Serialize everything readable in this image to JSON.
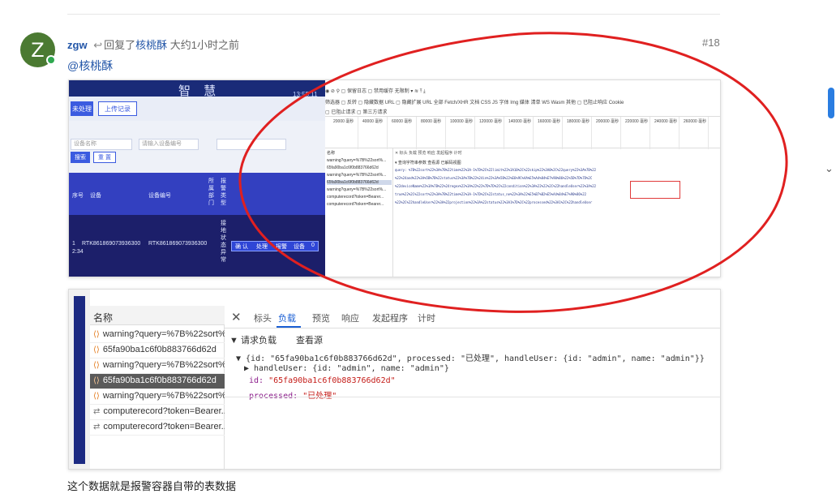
{
  "post": {
    "author": "zgw",
    "avatar_letter": "Z",
    "reply_prefix": "回复了",
    "reply_to": "核桃酥",
    "time": "大约1小时之前",
    "post_number": "#18",
    "mention": "@核桃酥",
    "caption": "这个数据就是报警容器自带的表数据"
  },
  "screenshot1": {
    "app": {
      "title": "智 慧",
      "time": "13:55:11",
      "tab_active": "未处理",
      "tab_other": "上传记录",
      "search_btn": "搜索",
      "reset_btn": "重 置",
      "device_name_placeholder": "设备名称",
      "device_no_placeholder": "请输入设备编号",
      "col_seq": "序号",
      "col_device": "设备",
      "col_device_no": "设备编号",
      "col_dept": "所属部门",
      "col_type": "报警类型",
      "row_index": "1",
      "row_time": "2:34",
      "row_device": "RTK861869073936300",
      "row_device_no": "RTK861869073936300",
      "row_status": "接地状态异常",
      "action_confirm": "确 认",
      "action_handle": "处理",
      "action_alarm": "报警",
      "action_device": "设备",
      "action_count": "0"
    },
    "devtools": {
      "toolbar": "◉  ⊘  ⚲  ▢ 保留日志  ▢ 禁用缓存  无限制  ▾  ≋  ⤒  ⤓",
      "filter_row": "筛选器      ▢ 反转  ▢ 隐藏数据 URL  ▢ 隐藏扩展 URL   全部  Fetch/XHR  文档  CSS  JS  字体  Img  媒体  清单  WS  Wasm  其他   ▢ 已阻止响应 Cookie",
      "filter_row2": "▢ 已阻止请求  ▢ 第三方请求",
      "timeline_labels": [
        "20000 毫秒",
        "40000 毫秒",
        "60000 毫秒",
        "80000 毫秒",
        "100000 毫秒",
        "120000 毫秒",
        "140000 毫秒",
        "160000 毫秒",
        "180000 毫秒",
        "200000 毫秒",
        "220000 毫秒",
        "240000 毫秒",
        "260000 毫秒"
      ],
      "names_header": "名称",
      "names": [
        "warning?query=%7B%22sort%...",
        "65fa90ba1c6f0b883766d62d",
        "warning?query=%7B%22sort%...",
        "65fa90ba1c6f0b883766d62d",
        "warning?query=%7B%22sort%...",
        "computerecord?token=Bearer...",
        "computerecord?token=Bearer..."
      ],
      "detail_tabs": "✕  标头   负载   预览   响应   发起程序   计时",
      "payload_title": "▾ 查询字符串参数      查看源       已解码视图",
      "payload_lines": [
        "query: %7B%22sort%22%3A%7B%22time%22%3A-1%7D%2C%22limit%22%3A10%2C%22skip%22%3A0%2C%22query%22%3A%7B%22",
        "%22%24and%22%3A%5B%7B%22status%22%3A%7B%22%24in%22%3A%5B%22%E6%9C%AA%E5%A4%84%E7%90%86%22%5D%7D%7D%2C",
        "%22deviceName%22%3A%7B%22%24regex%22%3A%22%22%7D%7D%2C%22condition%22%3A%22%22%2C%22handleUser%22%3A%22",
        "true%22%2C%22sort%22%3A%7B%22time%22%3A-1%7D%2C%22status_ne%22%3A%22%E5%B7%B2%E5%A4%84%E7%90%86%22",
        "%22%2C%22handleUser%22%3A%22projection%22%3A%22status%22%3A1%7D%2C%22processed%22%3A1%2C%22handleUser"
      ]
    }
  },
  "screenshot2": {
    "names_header": "名称",
    "names": [
      {
        "icon": "xhr",
        "label": "warning?query=%7B%22sort%..."
      },
      {
        "icon": "xhr",
        "label": "65fa90ba1c6f0b883766d62d"
      },
      {
        "icon": "xhr",
        "label": "warning?query=%7B%22sort%..."
      },
      {
        "icon": "xhr",
        "label": "65fa90ba1c6f0b883766d62d"
      },
      {
        "icon": "xhr",
        "label": "warning?query=%7B%22sort%..."
      },
      {
        "icon": "fetch",
        "label": "computerecord?token=Bearer..."
      },
      {
        "icon": "fetch",
        "label": "computerecord?token=Bearer..."
      }
    ],
    "selected_index": 3,
    "tabs": [
      "标头",
      "负载",
      "预览",
      "响应",
      "发起程序",
      "计时"
    ],
    "active_tab": "负载",
    "section_title": "▼ 请求负载",
    "view_source": "查看源",
    "tree": {
      "root": "▼ {id: \"65fa90ba1c6f0b883766d62d\", processed: \"已处理\", handleUser: {id: \"admin\", name: \"admin\"}}",
      "handle_user_line": "▶ handleUser: {id: \"admin\", name: \"admin\"}",
      "id_key": "id:",
      "id_value": "\"65fa90ba1c6f0b883766d62d\"",
      "processed_key": "processed:",
      "processed_value": "\"已处理\""
    }
  },
  "colors": {
    "link": "#2356a8",
    "avatar_bg": "#4b7a32",
    "annotation_red": "#e02020",
    "tab_active": "#1a5fd4",
    "selected_row": "#5a5a5a"
  }
}
